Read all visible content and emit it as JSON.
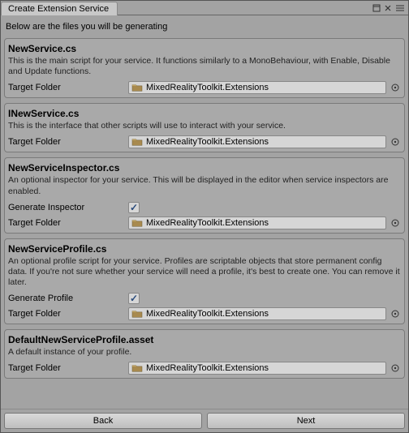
{
  "window": {
    "title": "Create Extension Service",
    "intro": "Below are the files you will be generating"
  },
  "labels": {
    "targetFolder": "Target Folder",
    "generateInspector": "Generate Inspector",
    "generateProfile": "Generate Profile"
  },
  "common": {
    "folder": "MixedRealityToolkit.Extensions"
  },
  "panels": [
    {
      "title": "NewService.cs",
      "desc": "This is the main script for your service. It functions similarly to a MonoBehaviour, with Enable, Disable and Update functions.",
      "rows": [
        {
          "type": "folder",
          "labelKey": "targetFolder",
          "valueKey": "common.folder"
        }
      ]
    },
    {
      "title": "INewService.cs",
      "desc": "This is the interface that other scripts will use to interact with your service.",
      "rows": [
        {
          "type": "folder",
          "labelKey": "targetFolder",
          "valueKey": "common.folder"
        }
      ]
    },
    {
      "title": "NewServiceInspector.cs",
      "desc": "An optional inspector for your service. This will be displayed in the editor when service inspectors are enabled.",
      "rows": [
        {
          "type": "checkbox",
          "labelKey": "generateInspector",
          "checked": true
        },
        {
          "type": "folder",
          "labelKey": "targetFolder",
          "valueKey": "common.folder"
        }
      ]
    },
    {
      "title": "NewServiceProfile.cs",
      "desc": "An optional profile script for your service. Profiles are scriptable objects that store permanent config data. If you're not sure whether your service will need a profile, it's best to create one. You can remove it later.",
      "rows": [
        {
          "type": "checkbox",
          "labelKey": "generateProfile",
          "checked": true
        },
        {
          "type": "folder",
          "labelKey": "targetFolder",
          "valueKey": "common.folder"
        }
      ]
    },
    {
      "title": "DefaultNewServiceProfile.asset",
      "desc": "A default instance of your profile.",
      "rows": [
        {
          "type": "folder",
          "labelKey": "targetFolder",
          "valueKey": "common.folder"
        }
      ]
    }
  ],
  "footer": {
    "back": "Back",
    "next": "Next"
  }
}
